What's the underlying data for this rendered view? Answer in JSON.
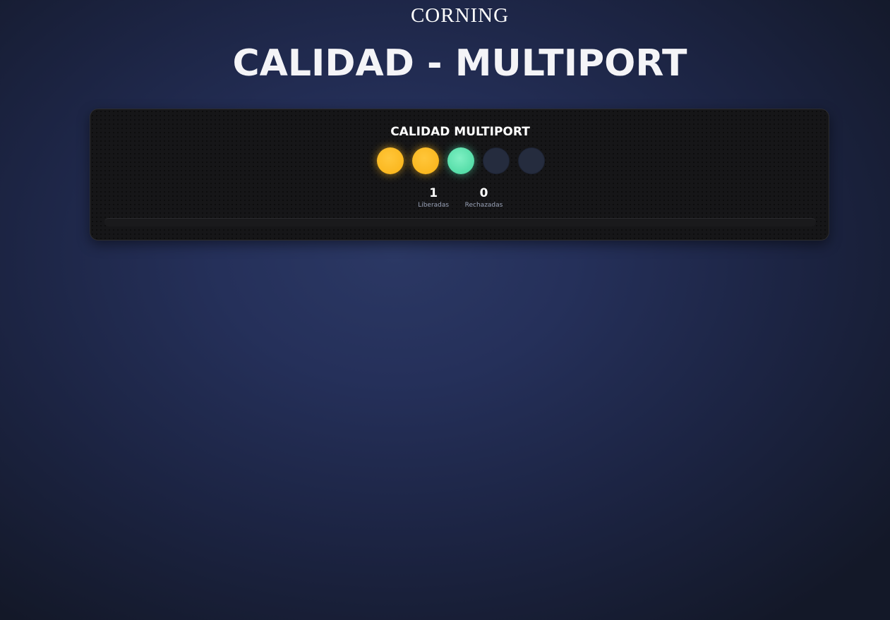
{
  "brand": "CORNING",
  "page_title": "CALIDAD - MULTIPORT",
  "panel": {
    "title": "CALIDAD MULTIPORT",
    "lights": [
      {
        "state": "yellow",
        "color": "#fbb820"
      },
      {
        "state": "yellow",
        "color": "#fbb820"
      },
      {
        "state": "green",
        "color": "#55dda8"
      },
      {
        "state": "off",
        "color": "#252c3e"
      },
      {
        "state": "off",
        "color": "#252c3e"
      }
    ],
    "stats": [
      {
        "value": "1",
        "label": "Liberadas"
      },
      {
        "value": "0",
        "label": "Rechazadas"
      }
    ]
  }
}
